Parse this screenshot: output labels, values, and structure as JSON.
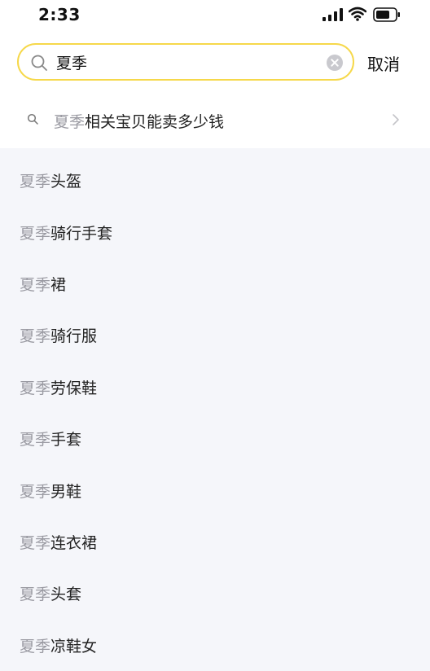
{
  "status_bar": {
    "time": "2:33"
  },
  "search": {
    "query": "夏季",
    "cancel_label": "取消"
  },
  "suggestion": {
    "highlight": "夏季",
    "rest": "相关宝贝能卖多少钱"
  },
  "results": [
    {
      "highlight": "夏季",
      "rest": "头盔"
    },
    {
      "highlight": "夏季",
      "rest": "骑行手套"
    },
    {
      "highlight": "夏季",
      "rest": "裙"
    },
    {
      "highlight": "夏季",
      "rest": "骑行服"
    },
    {
      "highlight": "夏季",
      "rest": "劳保鞋"
    },
    {
      "highlight": "夏季",
      "rest": "手套"
    },
    {
      "highlight": "夏季",
      "rest": "男鞋"
    },
    {
      "highlight": "夏季",
      "rest": "连衣裙"
    },
    {
      "highlight": "夏季",
      "rest": "头套"
    },
    {
      "highlight": "夏季",
      "rest": "凉鞋女"
    }
  ],
  "colors": {
    "accent_border": "#f6d84a",
    "highlight_text": "#9a9aa2",
    "list_background": "#f5f6fa"
  },
  "icons": [
    "signal-icon",
    "wifi-icon",
    "battery-icon",
    "search-icon",
    "clear-icon",
    "chevron-right-icon"
  ]
}
